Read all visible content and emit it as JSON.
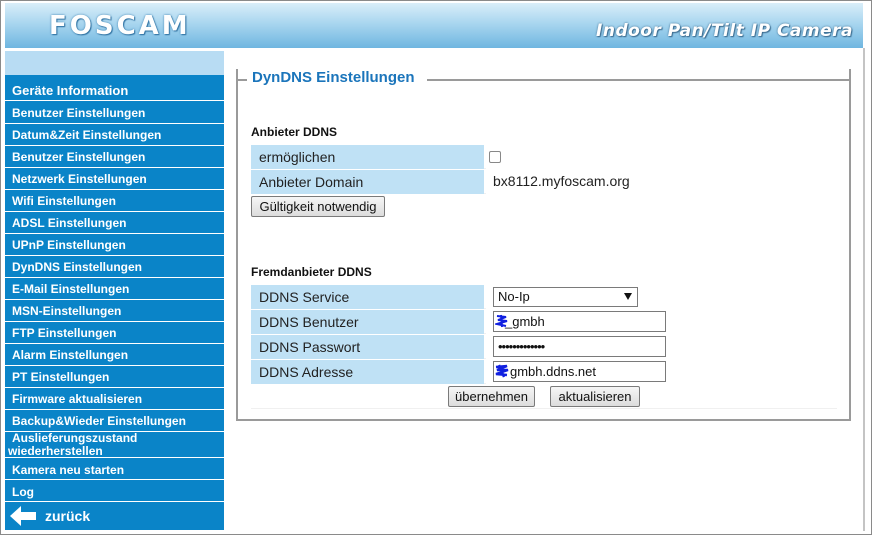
{
  "header": {
    "logo": "FOSCAM",
    "product": "Indoor Pan/Tilt IP Camera"
  },
  "sidebar": {
    "items": [
      {
        "label": "Geräte Information"
      },
      {
        "label": "Benutzer Einstellungen"
      },
      {
        "label": "Datum&Zeit Einstellungen"
      },
      {
        "label": "Benutzer Einstellungen"
      },
      {
        "label": "Netzwerk Einstellungen"
      },
      {
        "label": "Wifi Einstellungen"
      },
      {
        "label": "ADSL Einstellungen"
      },
      {
        "label": "UPnP Einstellungen"
      },
      {
        "label": "DynDNS Einstellungen"
      },
      {
        "label": "E-Mail Einstellungen"
      },
      {
        "label": "MSN-Einstellungen"
      },
      {
        "label": "FTP Einstellungen"
      },
      {
        "label": "Alarm Einstellungen"
      },
      {
        "label": "PT Einstellungen"
      },
      {
        "label": "Firmware aktualisieren"
      },
      {
        "label": "Backup&Wieder Einstellungen"
      },
      {
        "label": "Auslieferungszustand",
        "label2": "wiederherstellen"
      },
      {
        "label": "Kamera neu starten"
      },
      {
        "label": "Log"
      }
    ],
    "back_label": "zurück"
  },
  "main": {
    "legend": "DynDNS Einstellungen",
    "provider_section": {
      "title": "Anbieter DDNS",
      "enable_label": "ermöglichen",
      "enable_checked": false,
      "domain_label": "Anbieter Domain",
      "domain_value": "bx8112.myfoscam.org",
      "validity_button": "Gültigkeit notwendig"
    },
    "third_party_section": {
      "title": "Fremdanbieter DDNS",
      "service_label": "DDNS Service",
      "service_value": "No-Ip",
      "user_label": "DDNS Benutzer",
      "user_value": "_gmbh",
      "password_label": "DDNS Passwort",
      "password_value": "•••••••••••••",
      "address_label": "DDNS Adresse",
      "address_value": "gmbh.ddns.net",
      "apply_button": "übernehmen",
      "refresh_button": "aktualisieren"
    }
  }
}
